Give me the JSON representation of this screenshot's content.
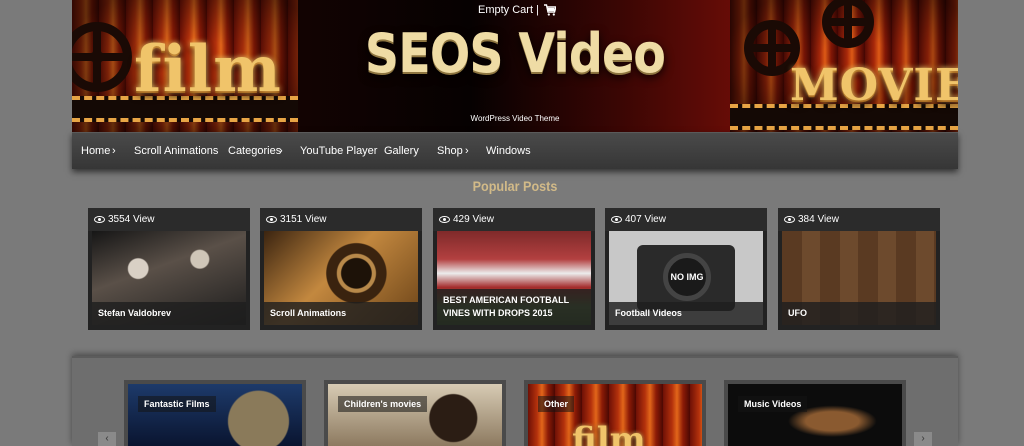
{
  "header": {
    "site_title": "SEOS Video",
    "tagline": "WordPress Video Theme",
    "cart_label": "Empty Cart |",
    "cart_icon": "cart-icon",
    "logo_left": "film",
    "logo_right": "MOVIE"
  },
  "nav": {
    "items": [
      {
        "label": "Home",
        "has_submenu": true
      },
      {
        "label": "Scroll Animations",
        "has_submenu": false
      },
      {
        "label": "Categories",
        "has_submenu": true
      },
      {
        "label": "YouTube Player",
        "has_submenu": false
      },
      {
        "label": "Gallery",
        "has_submenu": false
      },
      {
        "label": "Shop",
        "has_submenu": true
      },
      {
        "label": "Windows",
        "has_submenu": false
      }
    ],
    "caret": "›"
  },
  "popular": {
    "title": "Popular Posts",
    "posts": [
      {
        "views": "3554 View",
        "caption": "Stefan Valdobrev"
      },
      {
        "views": "3151 View",
        "caption": "Scroll Animations"
      },
      {
        "views": "429 View",
        "caption": "BEST AMERICAN FOOTBALL VINES WITH DROPS 2015"
      },
      {
        "views": "407 View",
        "caption": "Football Videos",
        "placeholder": "NO IMG"
      },
      {
        "views": "384 View",
        "caption": "UFO"
      }
    ]
  },
  "categories": {
    "items": [
      {
        "label": "Fantastic Films"
      },
      {
        "label": "Children's movies"
      },
      {
        "label": "Other",
        "image_text": "film"
      },
      {
        "label": "Music Videos"
      }
    ],
    "prev_arrow": "‹",
    "next_arrow": "›"
  },
  "colors": {
    "page_bg": "#7a7a7a",
    "nav_bg": "#3f3f3f",
    "accent_gold": "#d2ba88",
    "title_cream": "#efdca5"
  }
}
